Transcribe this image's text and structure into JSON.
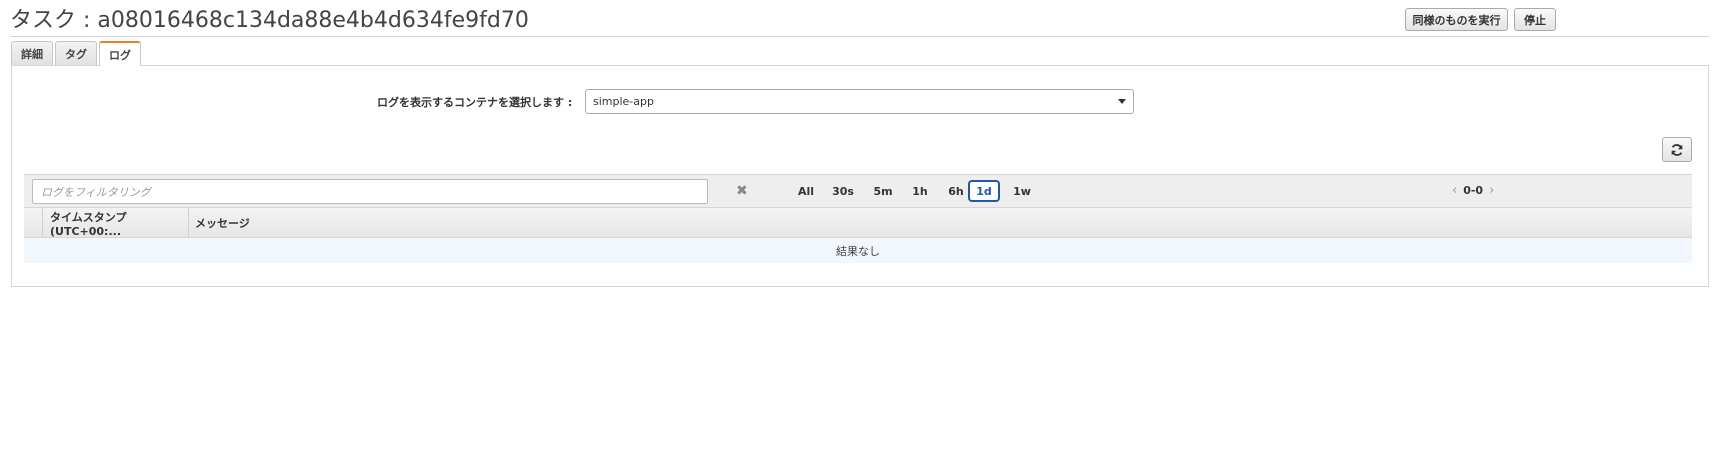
{
  "header": {
    "title": "タスク : a08016468c134da88e4b4d634fe9fd70",
    "run_same_label": "同様のものを実行",
    "stop_label": "停止"
  },
  "tabs": [
    {
      "label": "詳細",
      "active": false
    },
    {
      "label": "タグ",
      "active": false
    },
    {
      "label": "ログ",
      "active": true
    }
  ],
  "container_select": {
    "label": "ログを表示するコンテナを選択します :",
    "selected": "simple-app"
  },
  "filter": {
    "placeholder": "ログをフィルタリング"
  },
  "time_ranges": [
    {
      "label": "All",
      "active": false
    },
    {
      "label": "30s",
      "active": false
    },
    {
      "label": "5m",
      "active": false
    },
    {
      "label": "1h",
      "active": false
    },
    {
      "label": "6h",
      "active": false
    },
    {
      "label": "1d",
      "active": true
    },
    {
      "label": "1w",
      "active": false
    }
  ],
  "pagination": {
    "range": "0-0"
  },
  "table": {
    "columns": [
      "タイムスタンプ (UTC+00:...",
      "メッセージ"
    ],
    "empty_text": "結果なし"
  },
  "icons": {
    "refresh": "refresh-icon",
    "clear": "clear-icon",
    "dropdown": "chevron-down-icon",
    "prev": "chevron-left-icon",
    "next": "chevron-right-icon"
  },
  "colors": {
    "active_tab_accent": "#e7812b",
    "active_range": "#1f5aa8",
    "empty_row_bg": "#f1f7fd"
  }
}
